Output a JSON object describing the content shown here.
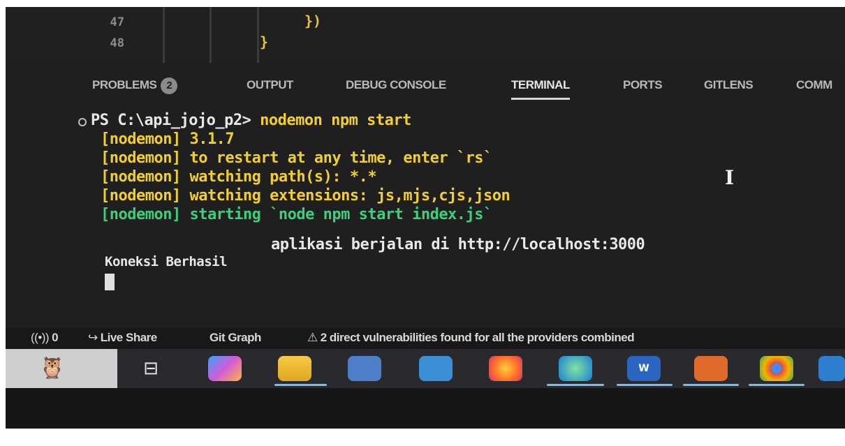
{
  "editor": {
    "lines": [
      {
        "number": "47",
        "code": "})"
      },
      {
        "number": "48",
        "code": "}"
      }
    ]
  },
  "panel": {
    "tabs": [
      {
        "label": "PROBLEMS",
        "badge": "2"
      },
      {
        "label": "OUTPUT"
      },
      {
        "label": "DEBUG CONSOLE"
      },
      {
        "label": "TERMINAL",
        "active": true
      },
      {
        "label": "PORTS"
      },
      {
        "label": "GITLENS"
      },
      {
        "label": "COMM"
      }
    ]
  },
  "terminal": {
    "prompt": "PS C:\\api_jojo_p2>",
    "command": "nodemon npm start",
    "lines": [
      "[nodemon] 3.1.7",
      "[nodemon] to restart at any time, enter `rs`",
      "[nodemon] watching path(s): *.*",
      "[nodemon] watching extensions: js,mjs,cjs,json",
      "[nodemon] starting `node npm start index.js`"
    ],
    "server_message": "aplikasi berjalan di http://localhost:3000",
    "db_message": "Koneksi Berhasil"
  },
  "statusbar": {
    "ports": "0",
    "live_share": "Live Share",
    "git_graph": "Git Graph",
    "vulnerabilities": "2 direct vulnerabilities found for all the providers combined"
  },
  "taskbar": {
    "icons": [
      "task-view-icon",
      "copilot-icon",
      "file-explorer-icon",
      "microsoft-store-icon",
      "mail-icon",
      "firefox-icon",
      "edge-icon",
      "word-icon",
      "xampp-icon",
      "chrome-icon",
      "vscode-icon"
    ]
  },
  "colors": {
    "terminal_yellow": "#f2cf2d",
    "terminal_green": "#3ccf7c",
    "terminal_white": "#e8e8e8"
  }
}
